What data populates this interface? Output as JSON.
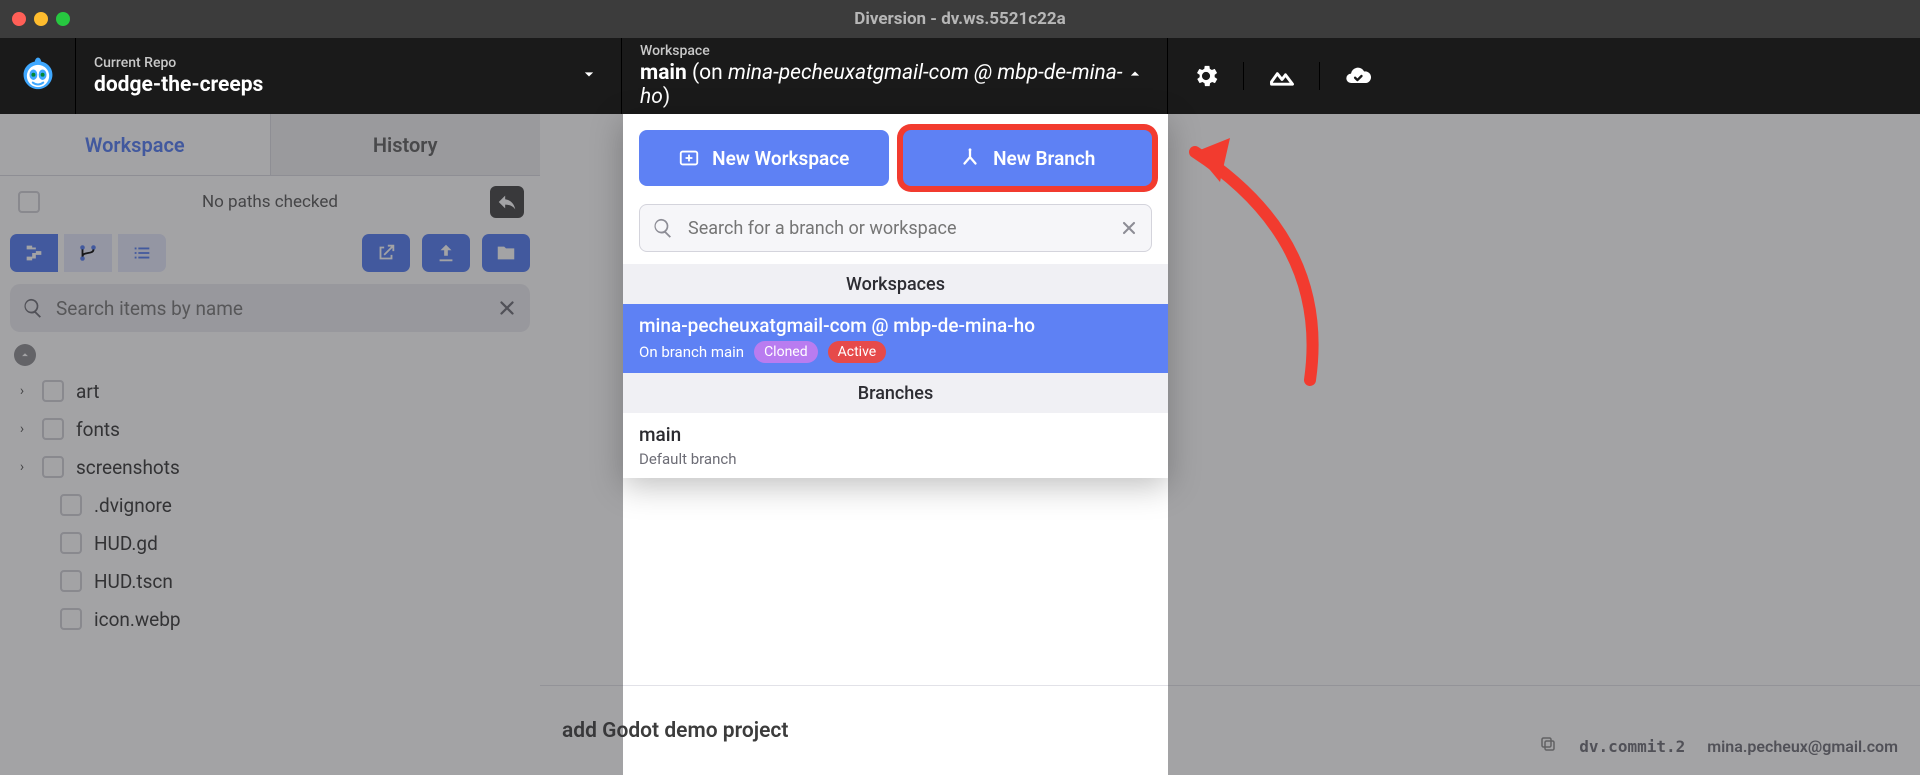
{
  "window": {
    "title": "Diversion - dv.ws.5521c22a"
  },
  "header": {
    "repo_label": "Current Repo",
    "repo_name": "dodge-the-creeps",
    "workspace_label": "Workspace",
    "ws_main": "main",
    "ws_on": " (on ",
    "ws_user": "mina-pecheuxatgmail-com @ mbp-de-mina-ho",
    "ws_close": ")"
  },
  "tabs": {
    "workspace": "Workspace",
    "history": "History"
  },
  "paths": {
    "text": "No paths checked"
  },
  "search": {
    "placeholder": "Search items by name"
  },
  "tree": {
    "folders": [
      "art",
      "fonts",
      "screenshots"
    ],
    "files": [
      ".dvignore",
      "HUD.gd",
      "HUD.tscn",
      "icon.webp"
    ]
  },
  "dropdown": {
    "new_workspace": "New Workspace",
    "new_branch": "New Branch",
    "search_placeholder": "Search for a branch or workspace",
    "section_ws": "Workspaces",
    "ws_item": {
      "title": "mina-pecheuxatgmail-com @ mbp-de-mina-ho",
      "sub": "On branch main",
      "pill_cloned": "Cloned",
      "pill_active": "Active"
    },
    "section_br": "Branches",
    "br_item": {
      "title": "main",
      "sub": "Default branch"
    }
  },
  "commit": {
    "title": "add Godot demo project",
    "id": "dv.commit.2",
    "author": "mina.pecheux@gmail.com"
  }
}
